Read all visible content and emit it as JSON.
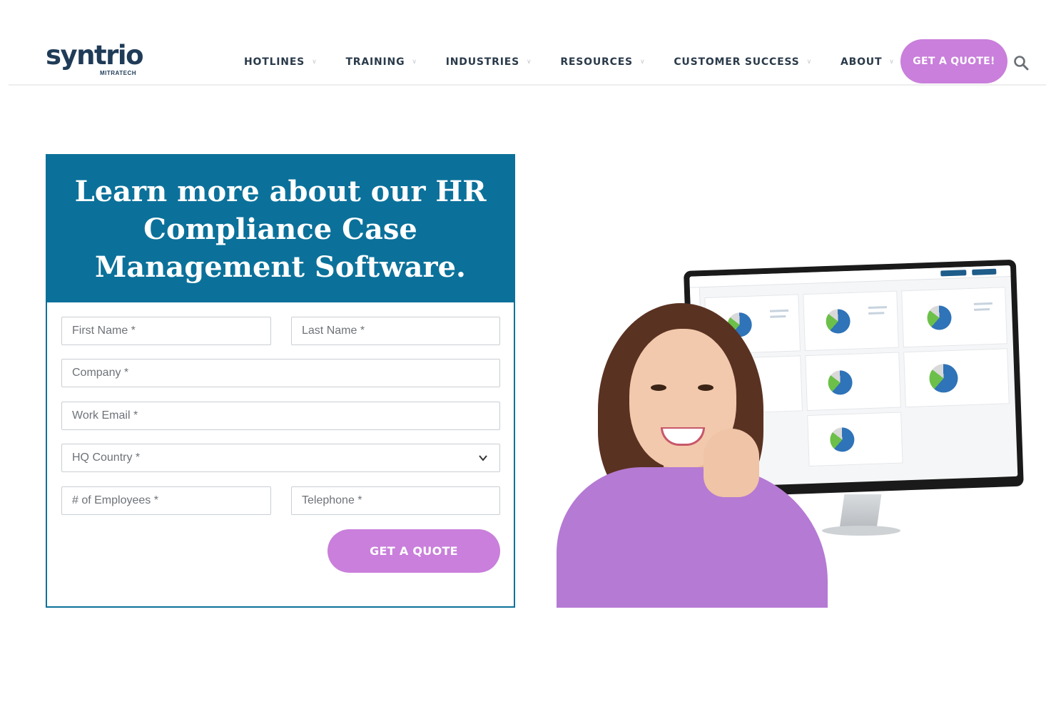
{
  "brand": {
    "name_main": "syntr",
    "name_io": "io",
    "tagline": "MITRATECH"
  },
  "nav": {
    "items": [
      {
        "label": "HOTLINES",
        "has_dropdown": true
      },
      {
        "label": "TRAINING",
        "has_dropdown": true
      },
      {
        "label": "INDUSTRIES",
        "has_dropdown": true
      },
      {
        "label": "RESOURCES",
        "has_dropdown": true
      },
      {
        "label": "CUSTOMER SUCCESS",
        "has_dropdown": true
      },
      {
        "label": "ABOUT",
        "has_dropdown": true
      }
    ],
    "cta_label": "GET A QUOTE!"
  },
  "form": {
    "title": "Learn more about our HR Compliance Case Management Software.",
    "fields": {
      "first_name": "First Name *",
      "last_name": "Last Name *",
      "company": "Company *",
      "work_email": "Work Email *",
      "hq_country": "HQ Country *",
      "employees": "# of Employees *",
      "telephone": "Telephone *"
    },
    "submit_label": "GET A QUOTE"
  },
  "colors": {
    "brand_blue": "#0b719a",
    "accent_purple": "#c97fdb",
    "logo_navy": "#1f3b57",
    "logo_teal": "#2bb3a3"
  },
  "icons": {
    "search": "search-icon",
    "dropdown": "chevron-down-icon"
  }
}
